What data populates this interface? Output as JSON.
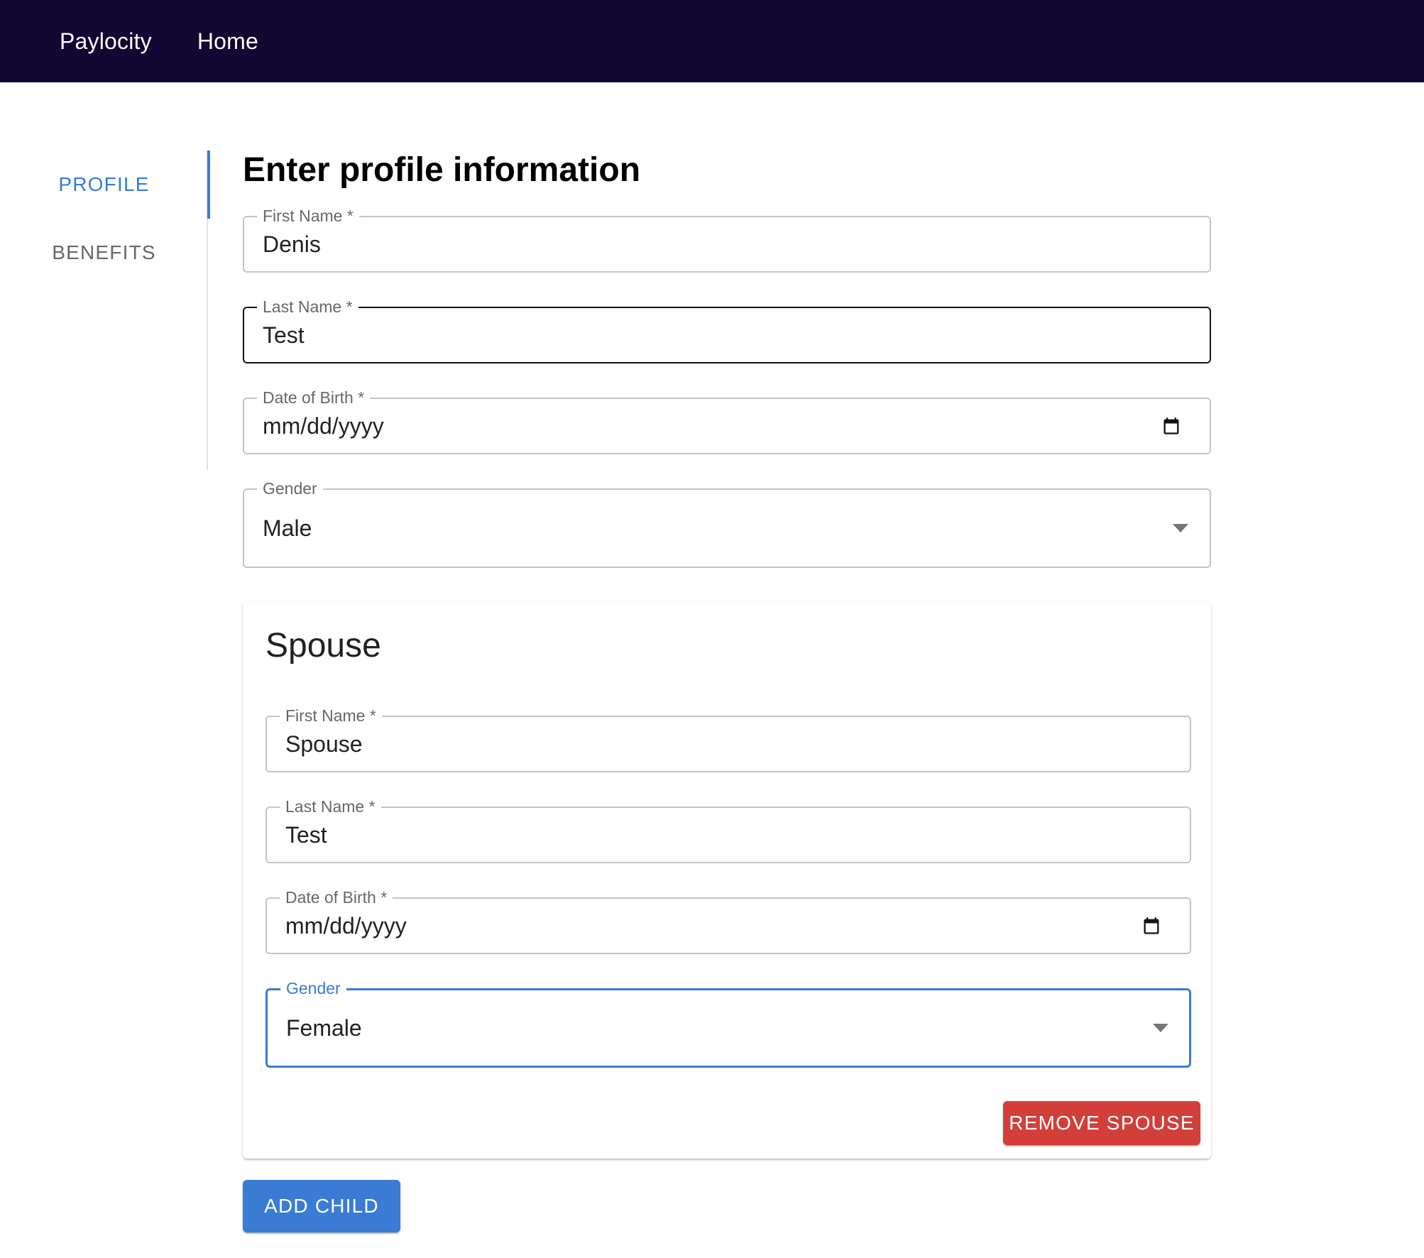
{
  "nav": {
    "brand": "Paylocity",
    "home": "Home"
  },
  "tabs": [
    {
      "label": "PROFILE",
      "active": true
    },
    {
      "label": "BENEFITS",
      "active": false
    }
  ],
  "main": {
    "title": "Enter profile information",
    "fields": {
      "first_name": {
        "label": "First Name *",
        "value": "Denis"
      },
      "last_name": {
        "label": "Last Name *",
        "value": "Test"
      },
      "dob": {
        "label": "Date of Birth *",
        "value": "mm/dd/yyyy",
        "icon": "calendar-icon"
      },
      "gender": {
        "label": "Gender",
        "value": "Male",
        "icon": "dropdown-arrow-icon"
      }
    }
  },
  "spouse": {
    "title": "Spouse",
    "fields": {
      "first_name": {
        "label": "First Name *",
        "value": "Spouse"
      },
      "last_name": {
        "label": "Last Name *",
        "value": "Test"
      },
      "dob": {
        "label": "Date of Birth *",
        "value": "mm/dd/yyyy",
        "icon": "calendar-icon"
      },
      "gender": {
        "label": "Gender",
        "value": "Female",
        "icon": "dropdown-arrow-icon"
      }
    },
    "remove_label": "REMOVE SPOUSE"
  },
  "add_child_label": "ADD CHILD",
  "colors": {
    "appbar": "#110731",
    "primary": "#3a7bd5",
    "danger": "#d23f3a"
  }
}
